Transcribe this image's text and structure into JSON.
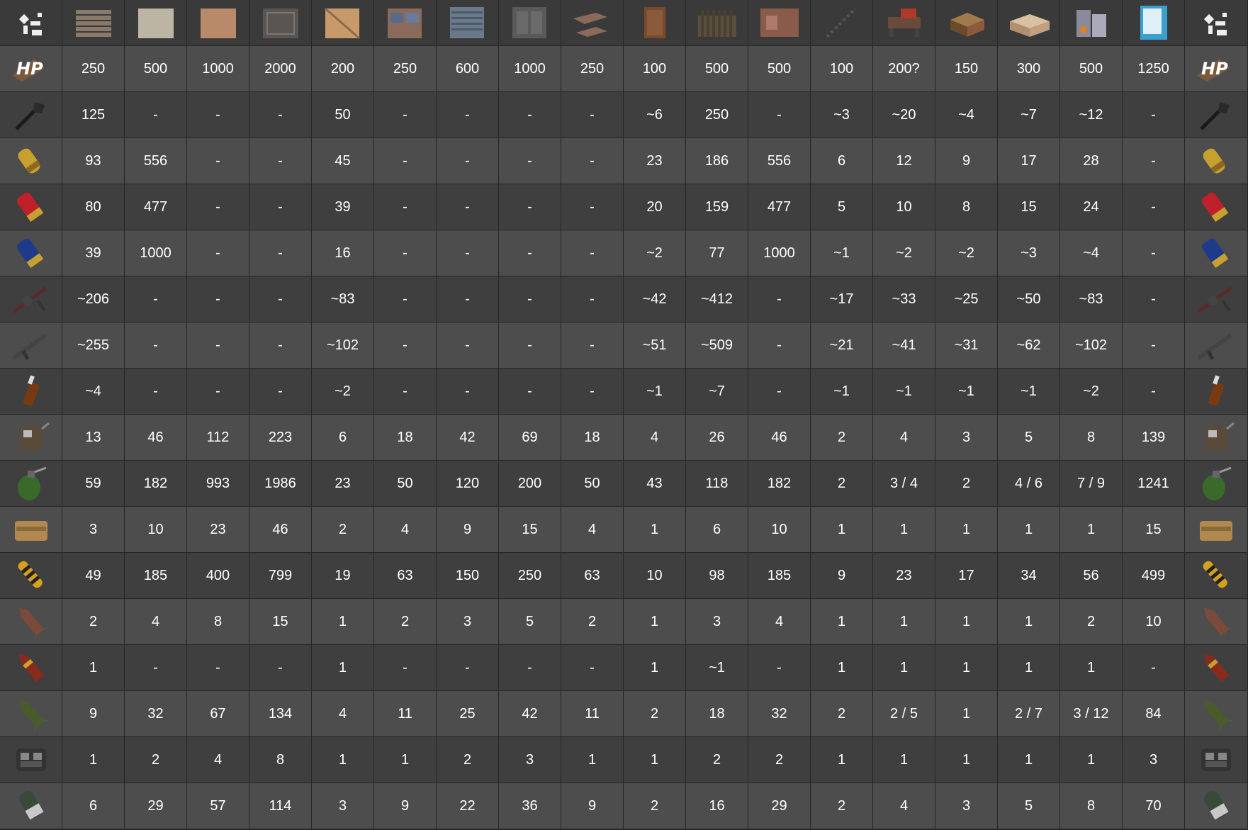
{
  "header_icons": [
    "wood-wall-icon",
    "stone-wall-icon",
    "sheet-metal-wall-icon",
    "armored-wall-icon",
    "wooden-door-icon",
    "sheet-metal-door-icon",
    "garage-door-icon",
    "armored-door-icon",
    "hatch-icon",
    "tool-cupboard-icon",
    "wooden-barricade-icon",
    "shop-front-icon",
    "ladder-hatch-icon",
    "workbench-icon",
    "wooden-box-icon",
    "large-box-icon",
    "furnace-icon",
    "vending-machine-icon"
  ],
  "corner_icon": "rust-logo-icon",
  "hp_label": "HP",
  "rows": [
    {
      "icon": "hp-icon",
      "values": [
        "250",
        "500",
        "1000",
        "2000",
        "200",
        "250",
        "600",
        "1000",
        "250",
        "100",
        "500",
        "500",
        "100",
        "200?",
        "150",
        "300",
        "500",
        "1250"
      ]
    },
    {
      "icon": "torch-icon",
      "values": [
        "125",
        "-",
        "-",
        "-",
        "50",
        "-",
        "-",
        "-",
        "-",
        "~6",
        "250",
        "-",
        "~3",
        "~20",
        "~4",
        "~7",
        "~12",
        "-"
      ]
    },
    {
      "icon": "fire-bullet-icon",
      "values": [
        "93",
        "556",
        "-",
        "-",
        "45",
        "-",
        "-",
        "-",
        "-",
        "23",
        "186",
        "556",
        "6",
        "12",
        "9",
        "17",
        "28",
        "-"
      ]
    },
    {
      "icon": "shotgun-shell-icon",
      "values": [
        "80",
        "477",
        "-",
        "-",
        "39",
        "-",
        "-",
        "-",
        "-",
        "20",
        "159",
        "477",
        "5",
        "10",
        "8",
        "15",
        "24",
        "-"
      ]
    },
    {
      "icon": "slug-icon",
      "values": [
        "39",
        "1000",
        "-",
        "-",
        "16",
        "-",
        "-",
        "-",
        "-",
        "~2",
        "77",
        "1000",
        "~1",
        "~2",
        "~2",
        "~3",
        "~4",
        "-"
      ]
    },
    {
      "icon": "flamethrower-icon",
      "values": [
        "~206",
        "-",
        "-",
        "-",
        "~83",
        "-",
        "-",
        "-",
        "-",
        "~42",
        "~412",
        "-",
        "~17",
        "~33",
        "~25",
        "~50",
        "~83",
        "-"
      ]
    },
    {
      "icon": "incendiary-rifle-icon",
      "values": [
        "~255",
        "-",
        "-",
        "-",
        "~102",
        "-",
        "-",
        "-",
        "-",
        "~51",
        "~509",
        "-",
        "~21",
        "~41",
        "~31",
        "~62",
        "~102",
        "-"
      ]
    },
    {
      "icon": "molotov-icon",
      "values": [
        "~4",
        "-",
        "-",
        "-",
        "~2",
        "-",
        "-",
        "-",
        "-",
        "~1",
        "~7",
        "-",
        "~1",
        "~1",
        "~1",
        "~1",
        "~2",
        "-"
      ]
    },
    {
      "icon": "beancan-grenade-icon",
      "values": [
        "13",
        "46",
        "112",
        "223",
        "6",
        "18",
        "42",
        "69",
        "18",
        "4",
        "26",
        "46",
        "2",
        "4",
        "3",
        "5",
        "8",
        "139"
      ]
    },
    {
      "icon": "f1-grenade-icon",
      "values": [
        "59",
        "182",
        "993",
        "1986",
        "23",
        "50",
        "120",
        "200",
        "50",
        "43",
        "118",
        "182",
        "2",
        "3 / 4",
        "2",
        "4 / 6",
        "7 / 9",
        "1241"
      ]
    },
    {
      "icon": "satchel-charge-icon",
      "values": [
        "3",
        "10",
        "23",
        "46",
        "2",
        "4",
        "9",
        "15",
        "4",
        "1",
        "6",
        "10",
        "1",
        "1",
        "1",
        "1",
        "1",
        "15"
      ]
    },
    {
      "icon": "explosive-ammo-icon",
      "values": [
        "49",
        "185",
        "400",
        "799",
        "19",
        "63",
        "150",
        "250",
        "63",
        "10",
        "98",
        "185",
        "9",
        "23",
        "17",
        "34",
        "56",
        "499"
      ]
    },
    {
      "icon": "rocket-icon",
      "values": [
        "2",
        "4",
        "8",
        "15",
        "1",
        "2",
        "3",
        "5",
        "2",
        "1",
        "3",
        "4",
        "1",
        "1",
        "1",
        "1",
        "2",
        "10"
      ]
    },
    {
      "icon": "incendiary-rocket-icon",
      "values": [
        "1",
        "-",
        "-",
        "-",
        "1",
        "-",
        "-",
        "-",
        "-",
        "1",
        "~1",
        "-",
        "1",
        "1",
        "1",
        "1",
        "1",
        "-"
      ]
    },
    {
      "icon": "hv-rocket-icon",
      "values": [
        "9",
        "32",
        "67",
        "134",
        "4",
        "11",
        "25",
        "42",
        "11",
        "2",
        "18",
        "32",
        "2",
        "2 / 5",
        "1",
        "2 / 7",
        "3 / 12",
        "84"
      ]
    },
    {
      "icon": "c4-icon",
      "values": [
        "1",
        "2",
        "4",
        "8",
        "1",
        "1",
        "2",
        "3",
        "1",
        "1",
        "2",
        "2",
        "1",
        "1",
        "1",
        "1",
        "1",
        "3"
      ]
    },
    {
      "icon": "grenade-launcher-he-icon",
      "values": [
        "6",
        "29",
        "57",
        "114",
        "3",
        "9",
        "22",
        "36",
        "9",
        "2",
        "16",
        "29",
        "2",
        "4",
        "3",
        "5",
        "8",
        "70"
      ]
    }
  ],
  "colors": {
    "row_light": "#4d4d4d",
    "row_dark": "#3f3f3f",
    "header_bg": "#3a3a3a",
    "text": "#ffffff"
  }
}
